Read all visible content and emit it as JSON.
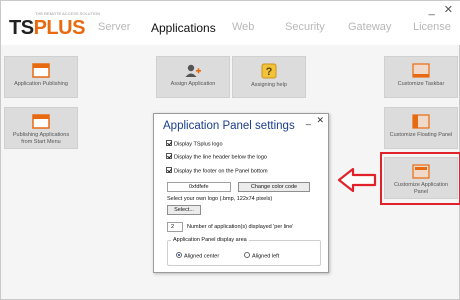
{
  "app": {
    "logo_ts": "TS",
    "logo_plus": "PLUS",
    "tagline": "THE REMOTE ACCESS SOLUTION"
  },
  "window_controls": {
    "minimize": "_",
    "close": "✕"
  },
  "nav": {
    "active": "Applications",
    "items": [
      "Server",
      "Applications",
      "Web",
      "Security",
      "Gateway",
      "License"
    ]
  },
  "tiles": {
    "app_publishing": "Application Publishing",
    "publishing_from_start": "Publishing Applications from Start Menu",
    "assign_app": "Assign Application",
    "assigning_help": "Assigning help",
    "customize_taskbar": "Customize Taskbar",
    "customize_floating": "Customize Floating Panel",
    "customize_app_panel": "Customize Application Panel"
  },
  "dialog": {
    "title": "Application Panel settings",
    "min": "_",
    "close": "✕",
    "chk_logo": "Display TSplus logo",
    "chk_header": "Display the line header below the logo",
    "chk_footer": "Display the footer on the Panel bottom",
    "color_value": "0xfdfefe",
    "change_color_btn": "Change color code",
    "logo_label": "Select your own logo (.bmp, 122x74 pixels)",
    "select_btn": "Select...",
    "apps_count": "2",
    "apps_count_label": "Number of application(s) displayed 'per line'",
    "area_title": "Application Panel display area",
    "radio_center": "Aligned center",
    "radio_left": "Aligned left",
    "selected_alignment": "Aligned center"
  },
  "colors": {
    "accent_orange": "#e86a10",
    "highlight_red": "#e0222b",
    "title_blue": "#1a3e8c",
    "tile_bg": "#dcdcdc"
  },
  "icons": {
    "app_publishing": "window-icon",
    "publishing_from_start": "window-icon",
    "assign_app": "user-add-icon",
    "assigning_help": "help-icon",
    "customize_taskbar": "panel-icon",
    "customize_floating": "panel-icon",
    "customize_app_panel": "panel-icon",
    "arrow": "arrow-left-icon"
  }
}
